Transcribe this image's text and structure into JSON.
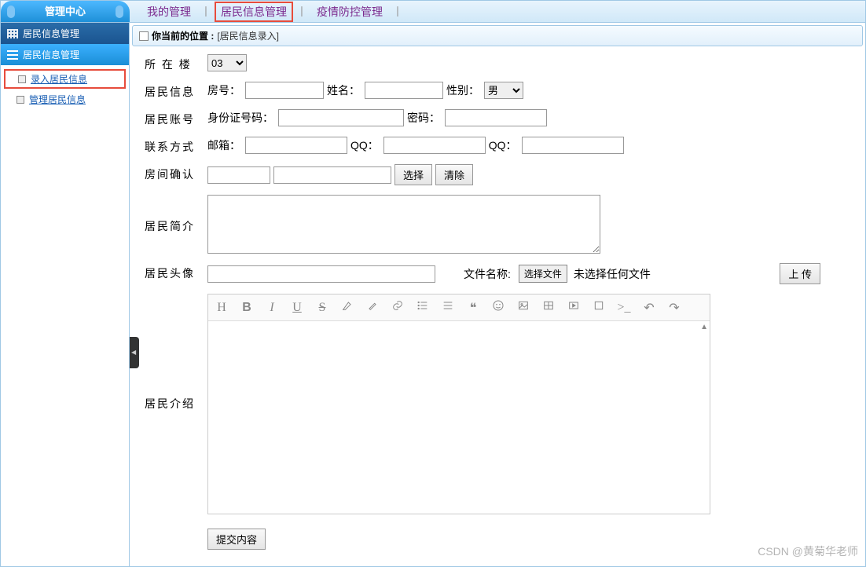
{
  "sidebar": {
    "title": "管理中心",
    "groups": [
      {
        "label": "居民信息管理",
        "active": false
      },
      {
        "label": "居民信息管理",
        "active": true
      }
    ],
    "items": [
      {
        "label": "录入居民信息",
        "highlighted": true
      },
      {
        "label": "管理居民信息",
        "highlighted": false
      }
    ]
  },
  "topnav": {
    "items": [
      {
        "label": "我的管理",
        "highlighted": false
      },
      {
        "label": "居民信息管理",
        "highlighted": true
      },
      {
        "label": "疫情防控管理",
        "highlighted": false
      }
    ],
    "sep": "丨"
  },
  "breadcrumb": {
    "label": "你当前的位置 :",
    "path": "[居民信息录入]"
  },
  "form": {
    "building_label": "所 在 楼",
    "building_value": "03",
    "resident_info_label": "居民信息",
    "room_label": "房号：",
    "name_label": "姓名：",
    "gender_label": "性别：",
    "gender_value": "男",
    "account_label": "居民账号",
    "id_label": "身份证号码：",
    "password_label": "密码：",
    "contact_label": "联系方式",
    "email_label": "邮箱：",
    "qq1_label": "QQ：",
    "qq2_label": "QQ：",
    "room_confirm_label": "房间确认",
    "select_btn": "选择",
    "clear_btn": "清除",
    "brief_label": "居民简介",
    "avatar_label": "居民头像",
    "file_label": "文件名称:",
    "file_btn": "选择文件",
    "file_status": "未选择任何文件",
    "upload_btn": "上 传",
    "intro_label": "居民介绍",
    "submit_btn": "提交内容"
  },
  "editor_icons": [
    "H",
    "B",
    "I",
    "U",
    "S",
    "marker",
    "brush",
    "link",
    "list",
    "align",
    "quote",
    "emoji",
    "image",
    "table",
    "video",
    "fullscreen",
    "code",
    "undo",
    "redo"
  ],
  "watermark": "CSDN @黄菊华老师"
}
